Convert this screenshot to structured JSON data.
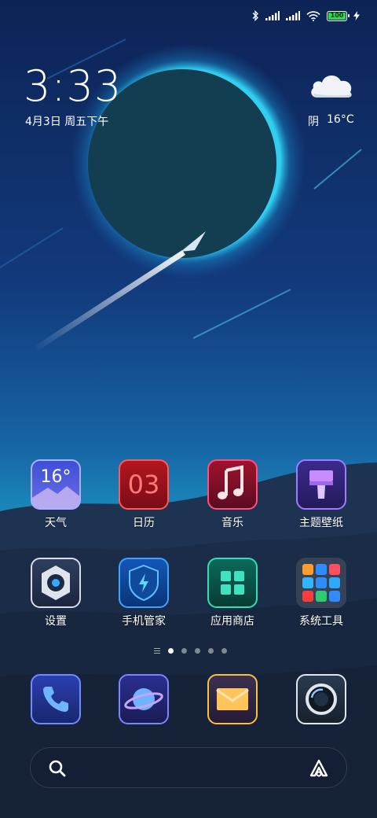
{
  "status_bar": {
    "icons": [
      "bluetooth-icon",
      "signal-icon",
      "signal-icon",
      "wifi-icon",
      "battery-icon",
      "charging-icon"
    ],
    "battery_level": "100",
    "battery_fraction": 1.0
  },
  "clock": {
    "time": "3:33",
    "date": "4月3日 周五下午"
  },
  "weather": {
    "icon": "cloud-icon",
    "condition": "阴",
    "temperature": "16°C"
  },
  "apps_row1": [
    {
      "label": "天气",
      "icon": "weather-app-icon",
      "icon_text": "16°"
    },
    {
      "label": "日历",
      "icon": "calendar-app-icon",
      "icon_text": "03"
    },
    {
      "label": "音乐",
      "icon": "music-app-icon"
    },
    {
      "label": "主题壁纸",
      "icon": "themes-app-icon"
    }
  ],
  "apps_row2": [
    {
      "label": "设置",
      "icon": "settings-app-icon"
    },
    {
      "label": "手机管家",
      "icon": "security-app-icon"
    },
    {
      "label": "应用商店",
      "icon": "app-store-icon"
    },
    {
      "label": "系统工具",
      "icon": "folder-icon"
    }
  ],
  "page_indicator": {
    "pages": 5,
    "active": 1
  },
  "dock": [
    {
      "icon": "phone-app-icon"
    },
    {
      "icon": "browser-app-icon"
    },
    {
      "icon": "messages-app-icon"
    },
    {
      "icon": "camera-app-icon"
    }
  ],
  "search": {
    "placeholder": "",
    "left_icon": "search-icon",
    "right_icon": "assistant-icon"
  },
  "colors": {
    "accent": "#2fd3ff",
    "battery": "#2ed94b"
  }
}
